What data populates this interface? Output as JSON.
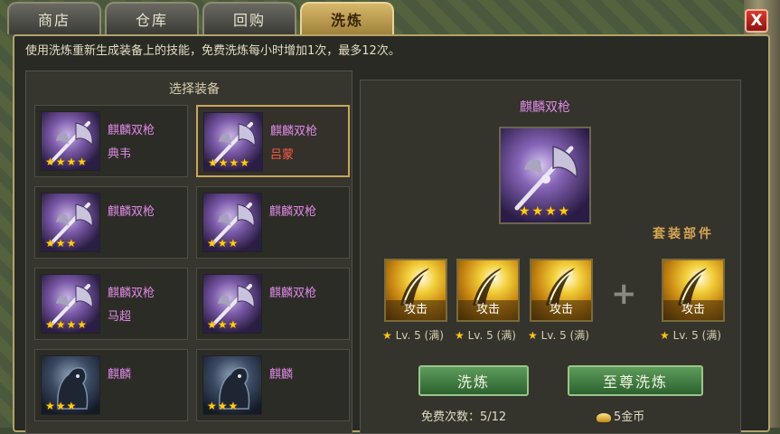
{
  "tabs": [
    {
      "label": "商店"
    },
    {
      "label": "仓库"
    },
    {
      "label": "回购"
    },
    {
      "label": "洗炼",
      "active": true
    }
  ],
  "close_label": "X",
  "info_text": "使用洗炼重新生成装备上的技能，免费洗炼每小时增加1次，最多12次。",
  "left": {
    "title": "选择装备",
    "items": [
      {
        "name": "麒麟双枪",
        "owner": "典韦",
        "stars": "★★★★",
        "icon": "weapon-icon"
      },
      {
        "name": "麒麟双枪",
        "owner": "吕蒙",
        "stars": "★★★★",
        "icon": "weapon-icon",
        "selected": true
      },
      {
        "name": "麒麟双枪",
        "owner": "",
        "stars": "★★★",
        "icon": "weapon-icon"
      },
      {
        "name": "麒麟双枪",
        "owner": "",
        "stars": "★★★",
        "icon": "weapon-icon"
      },
      {
        "name": "麒麟双枪",
        "owner": "马超",
        "stars": "★★★★",
        "icon": "weapon-icon"
      },
      {
        "name": "麒麟双枪",
        "owner": "",
        "stars": "★★★",
        "icon": "weapon-icon"
      },
      {
        "name": "麒麟",
        "owner": "",
        "stars": "★★★",
        "icon": "mount-icon"
      },
      {
        "name": "麒麟",
        "owner": "",
        "stars": "★★★",
        "icon": "mount-icon"
      }
    ]
  },
  "right": {
    "title": "麒麟双枪",
    "big_stars": "★★★★",
    "set_label": "套装部件",
    "skills": [
      {
        "label": "攻击",
        "level": "Lv. 5 (满)"
      },
      {
        "label": "攻击",
        "level": "Lv. 5 (满)"
      },
      {
        "label": "攻击",
        "level": "Lv. 5 (满)"
      },
      {
        "label": "攻击",
        "level": "Lv. 5 (满)"
      }
    ],
    "plus": "+",
    "refine_button": "洗炼",
    "supreme_refine_button": "至尊洗炼",
    "free_count": "免费次数：5/12",
    "gold_cost": "5金币"
  },
  "colors": {
    "accent": "#d7b86a",
    "owner_red": "#ff5a48",
    "item_name": "#dd8ae4",
    "star": "#ffcc1c"
  }
}
